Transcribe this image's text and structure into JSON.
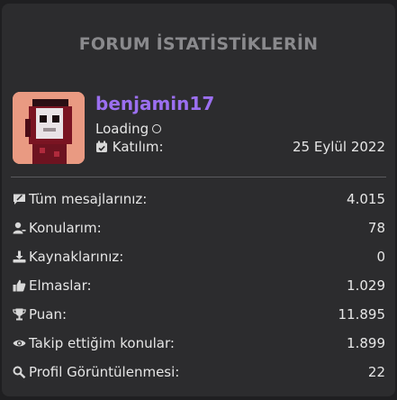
{
  "title": "FORUM İSTATİSTİKLERİN",
  "profile": {
    "username": "benjamin17",
    "status": "Loading",
    "joined_label": "Katılım:",
    "joined_value": "25 Eylül 2022"
  },
  "stats": [
    {
      "label": "Tüm mesajlarınız:",
      "value": "4.015",
      "icon": "message-icon"
    },
    {
      "label": "Konularım:",
      "value": "78",
      "icon": "user-icon"
    },
    {
      "label": "Kaynaklarınız:",
      "value": "0",
      "icon": "download-icon"
    },
    {
      "label": "Elmaslar:",
      "value": "1.029",
      "icon": "thumbs-up-icon"
    },
    {
      "label": "Puan:",
      "value": "11.895",
      "icon": "trophy-icon"
    },
    {
      "label": "Takip ettiğim konular:",
      "value": "1.899",
      "icon": "eye-icon"
    },
    {
      "label": "Profil Görüntülenmesi:",
      "value": "22",
      "icon": "search-icon"
    }
  ],
  "colors": {
    "username": "#9b6ff0",
    "panel": "#2c2c2e",
    "background": "#1f1f21"
  }
}
